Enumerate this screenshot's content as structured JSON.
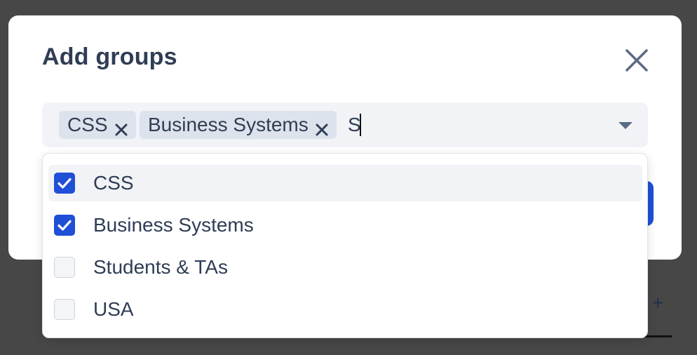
{
  "modal": {
    "title": "Add groups",
    "close_icon": "close-icon"
  },
  "select": {
    "chips": [
      {
        "label": "CSS"
      },
      {
        "label": "Business Systems"
      }
    ],
    "typed_value": "S",
    "remove_icon": "x-icon",
    "toggle_icon": "caret-down-icon"
  },
  "options": [
    {
      "label": "CSS",
      "checked": true,
      "highlighted": true
    },
    {
      "label": "Business Systems",
      "checked": true,
      "highlighted": false
    },
    {
      "label": "Students & TAs",
      "checked": false,
      "highlighted": false
    },
    {
      "label": "USA",
      "checked": false,
      "highlighted": false
    }
  ],
  "background": {
    "plus_symbol": "+"
  },
  "colors": {
    "accent": "#1f4fd6",
    "text": "#2f3d55",
    "field_bg": "#f1f3f6",
    "chip_bg": "#dde3ec",
    "overlay": "#474747"
  }
}
